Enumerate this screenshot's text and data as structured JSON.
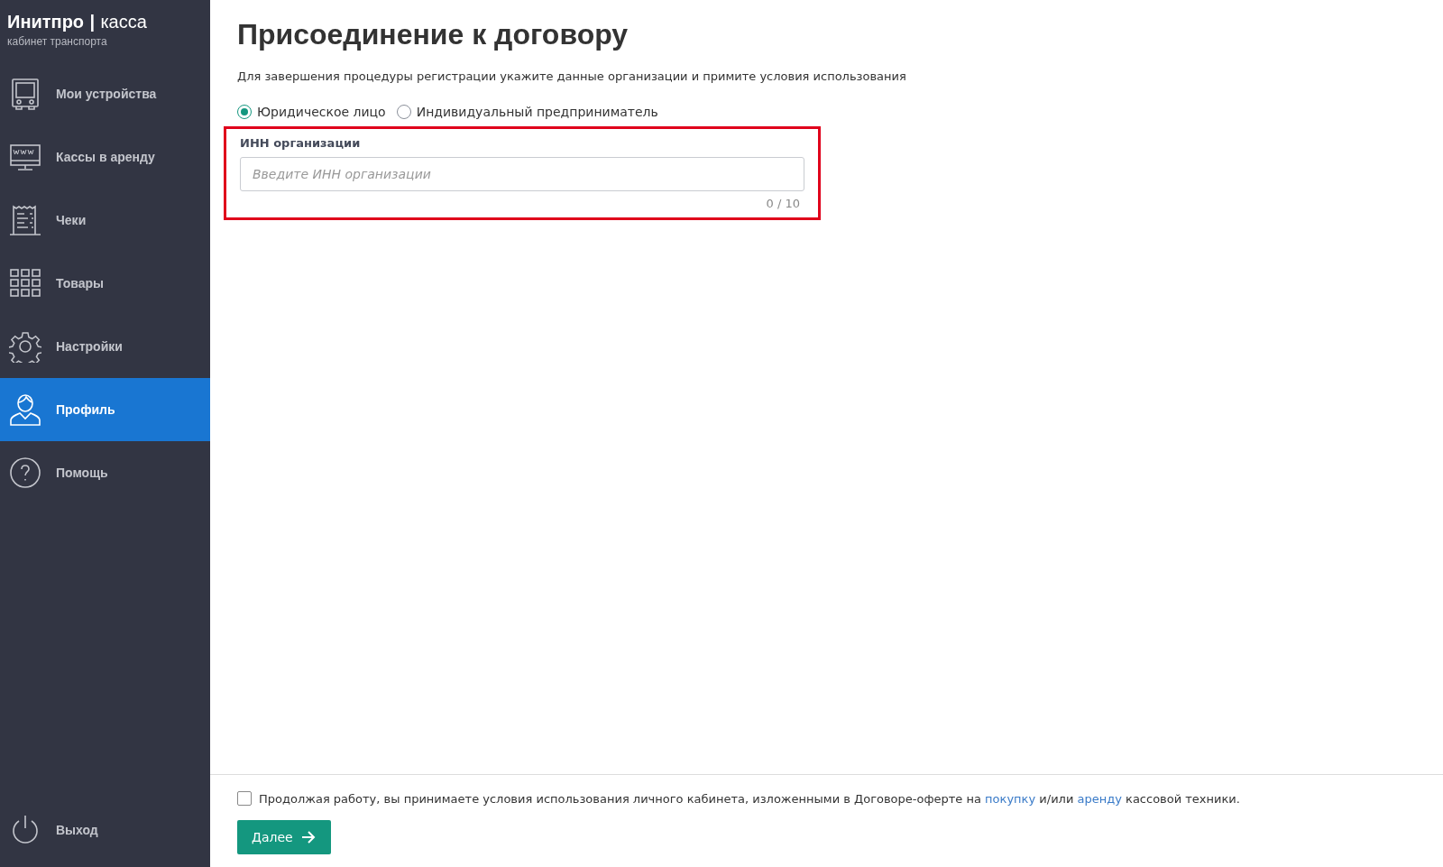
{
  "sidebar": {
    "brand": "Инитпро",
    "brand_separator": "|",
    "brand_product": "касса",
    "subtitle": "кабинет транспорта",
    "items": [
      {
        "label": "Мои устройства",
        "selected": false
      },
      {
        "label": "Кассы в аренду",
        "selected": false
      },
      {
        "label": "Чеки",
        "selected": false
      },
      {
        "label": "Товары",
        "selected": false
      },
      {
        "label": "Настройки",
        "selected": false
      },
      {
        "label": "Профиль",
        "selected": true
      },
      {
        "label": "Помощь",
        "selected": false
      }
    ],
    "logout": "Выход"
  },
  "page": {
    "title": "Присоединение к договору",
    "description": "Для завершения процедуры регистрации укажите данные организации и примите условия использования",
    "org_types": [
      {
        "label": "Юридическое лицо",
        "selected": true
      },
      {
        "label": "Индивидуальный предприниматель",
        "selected": false
      }
    ],
    "inn_field": {
      "label": "ИНН организации",
      "placeholder": "Введите ИНН организации",
      "counter": "0 / 10",
      "highlighted": true
    }
  },
  "footer": {
    "agree_checked": false,
    "terms": [
      {
        "kind": "text",
        "text": "Продолжая работу, вы принимаете условия использования личного кабинета, изложенными в Договоре-оферте на"
      },
      {
        "kind": "link",
        "text": "покупку"
      },
      {
        "kind": "text",
        "text": "и/или"
      },
      {
        "kind": "link",
        "text": "аренду"
      },
      {
        "kind": "text",
        "text": "кассовой техники."
      }
    ],
    "next_button": "Далее"
  }
}
